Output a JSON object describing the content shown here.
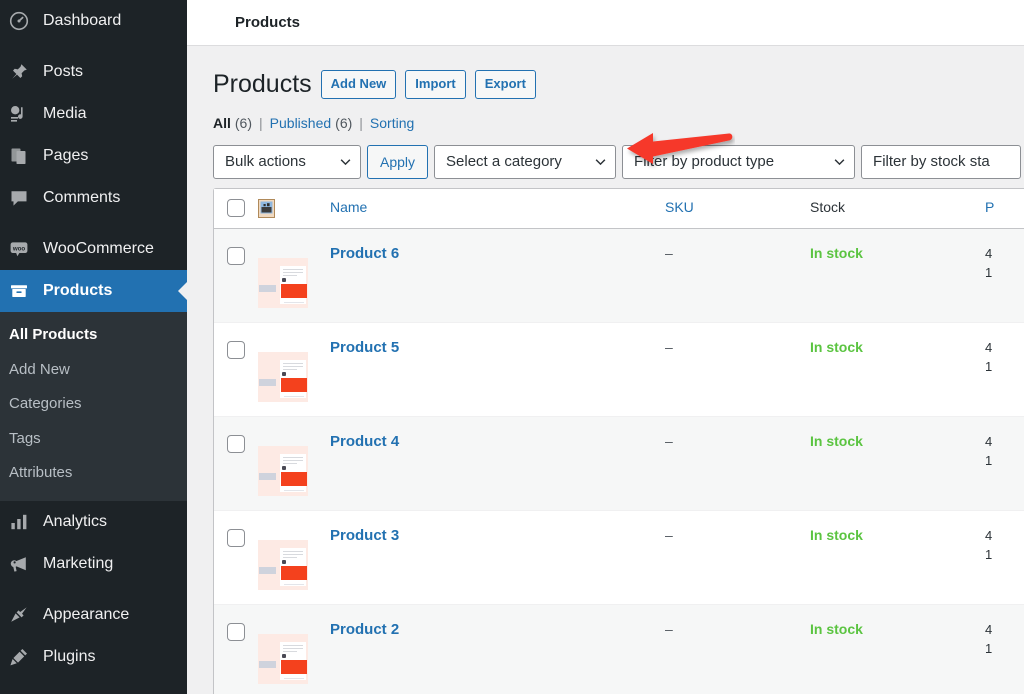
{
  "colors": {
    "sidebar_bg": "#1d2327",
    "submenu_bg": "#2c3338",
    "accent_blue": "#2271b1",
    "link_blue": "#2271b1",
    "instock_green": "#5bc441",
    "annotation_red": "#f6372b",
    "content_bg": "#f0f0f1"
  },
  "sidebar": {
    "items": [
      {
        "label": "Dashboard",
        "icon": "dashboard-icon",
        "current": false
      },
      {
        "label": "Posts",
        "icon": "pin-icon",
        "current": false
      },
      {
        "label": "Media",
        "icon": "media-icon",
        "current": false
      },
      {
        "label": "Pages",
        "icon": "pages-icon",
        "current": false
      },
      {
        "label": "Comments",
        "icon": "comments-icon",
        "current": false
      },
      {
        "label": "WooCommerce",
        "icon": "woocommerce-icon",
        "current": false
      },
      {
        "label": "Products",
        "icon": "products-icon",
        "current": true
      },
      {
        "label": "Analytics",
        "icon": "analytics-icon",
        "current": false
      },
      {
        "label": "Marketing",
        "icon": "marketing-icon",
        "current": false
      },
      {
        "label": "Appearance",
        "icon": "appearance-icon",
        "current": false
      },
      {
        "label": "Plugins",
        "icon": "plugins-icon",
        "current": false
      }
    ],
    "submenu": [
      {
        "label": "All Products",
        "current": true
      },
      {
        "label": "Add New",
        "current": false
      },
      {
        "label": "Categories",
        "current": false
      },
      {
        "label": "Tags",
        "current": false
      },
      {
        "label": "Attributes",
        "current": false
      }
    ]
  },
  "topbar": {
    "title": "Products"
  },
  "header": {
    "title": "Products",
    "buttons": [
      {
        "label": "Add New"
      },
      {
        "label": "Import"
      },
      {
        "label": "Export"
      }
    ]
  },
  "status_links": {
    "all_label": "All",
    "all_count": "(6)",
    "published_label": "Published",
    "published_count": "(6)",
    "sorting_label": "Sorting",
    "divider": "|"
  },
  "tablenav": {
    "bulk_actions": "Bulk actions",
    "apply_label": "Apply",
    "category_filter": "Select a category",
    "product_type_filter": "Filter by product type",
    "stock_status_filter": "Filter by stock sta"
  },
  "table": {
    "columns": {
      "image": "image-icon",
      "name": "Name",
      "sku": "SKU",
      "stock": "Stock",
      "price": "P"
    },
    "rows": [
      {
        "name": "Product 6",
        "sku": "–",
        "stock": "In stock",
        "price_regular": "4",
        "price_sale": "1"
      },
      {
        "name": "Product 5",
        "sku": "–",
        "stock": "In stock",
        "price_regular": "4",
        "price_sale": "1"
      },
      {
        "name": "Product 4",
        "sku": "–",
        "stock": "In stock",
        "price_regular": "4",
        "price_sale": "1"
      },
      {
        "name": "Product 3",
        "sku": "–",
        "stock": "In stock",
        "price_regular": "4",
        "price_sale": "1"
      },
      {
        "name": "Product 2",
        "sku": "–",
        "stock": "In stock",
        "price_regular": "4",
        "price_sale": "1"
      }
    ]
  },
  "annotation": {
    "shape": "left-pointing-arrow",
    "color": "#f6372b",
    "points_to": "Sorting"
  }
}
